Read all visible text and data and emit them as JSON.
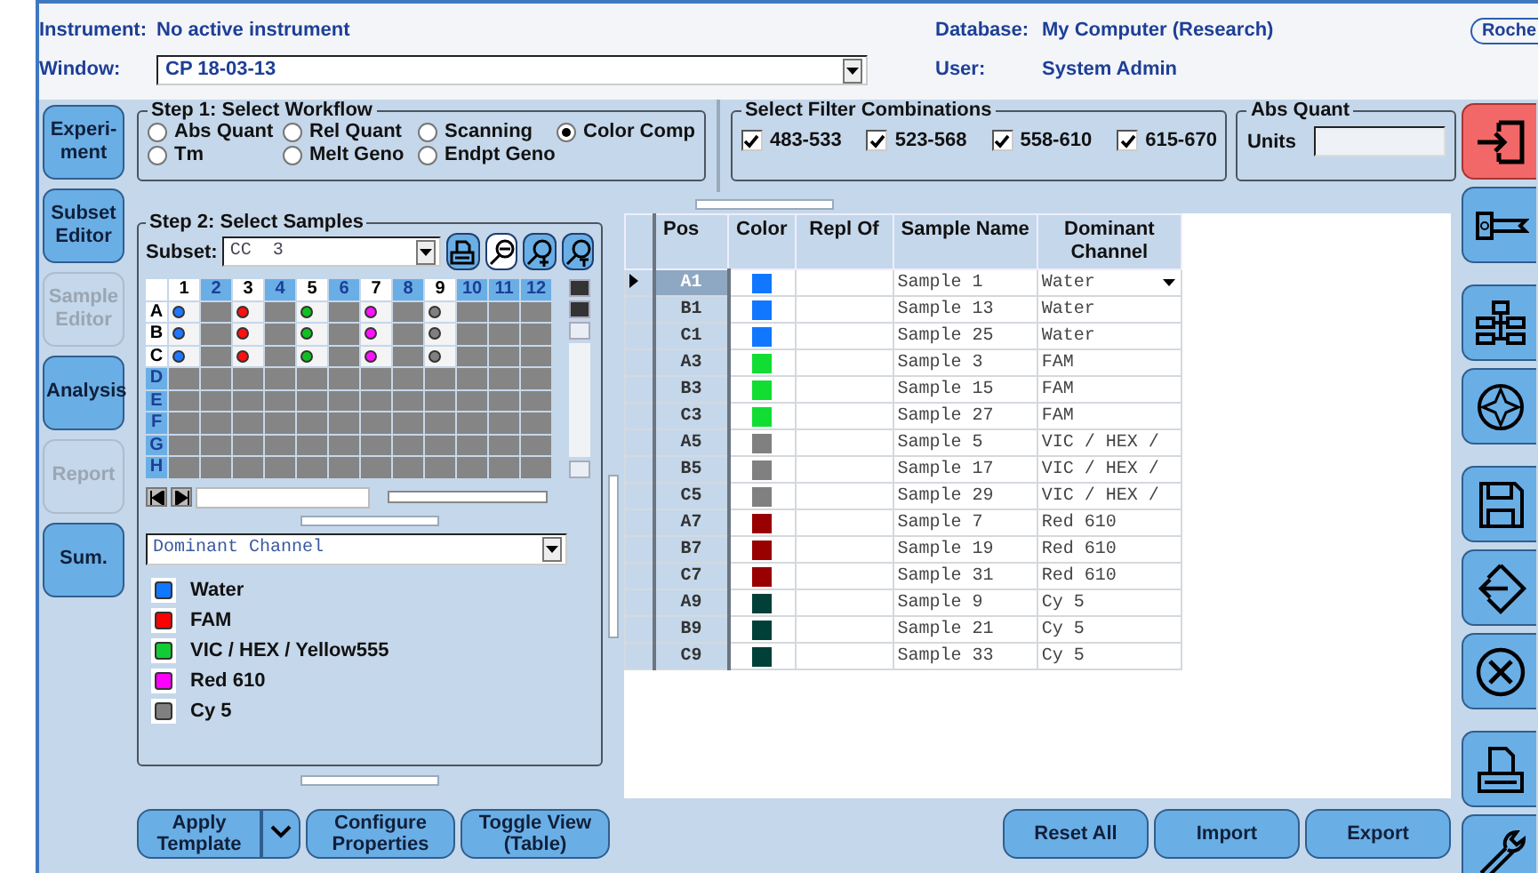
{
  "header": {
    "instrument_label": "Instrument:",
    "instrument": "No active instrument",
    "window_label": "Window:",
    "window_value": "CP 18-03-13",
    "database_label": "Database:",
    "database": "My Computer (Research)",
    "user_label": "User:",
    "user": "System Admin",
    "logo": "Roche"
  },
  "nav": [
    {
      "label": "Experi-ment",
      "disabled": false
    },
    {
      "label": "Subset Editor",
      "disabled": false
    },
    {
      "label": "Sample Editor",
      "disabled": true
    },
    {
      "label": "Analysis",
      "disabled": false
    },
    {
      "label": "Report",
      "disabled": true
    },
    {
      "label": "Sum.",
      "disabled": false
    }
  ],
  "step1": {
    "title": "Step 1: Select Workflow",
    "options": [
      {
        "label": "Abs Quant",
        "selected": false
      },
      {
        "label": "Rel Quant",
        "selected": false
      },
      {
        "label": "Scanning",
        "selected": false
      },
      {
        "label": "Color Comp",
        "selected": true
      },
      {
        "label": "Tm",
        "selected": false
      },
      {
        "label": "Melt Geno",
        "selected": false
      },
      {
        "label": "Endpt Geno",
        "selected": false
      }
    ]
  },
  "filters": {
    "title": "Select Filter Combinations",
    "items": [
      {
        "label": "483-533",
        "checked": true
      },
      {
        "label": "523-568",
        "checked": true
      },
      {
        "label": "558-610",
        "checked": true
      },
      {
        "label": "615-670",
        "checked": true
      }
    ]
  },
  "abs_quant": {
    "title": "Abs Quant",
    "units_label": "Units"
  },
  "step2": {
    "title": "Step 2: Select Samples",
    "subset_label": "Subset:",
    "subset": "CC  3",
    "plate": {
      "columns": [
        {
          "label": "1",
          "selected": true
        },
        {
          "label": "2",
          "selected": false
        },
        {
          "label": "3",
          "selected": true
        },
        {
          "label": "4",
          "selected": false
        },
        {
          "label": "5",
          "selected": true
        },
        {
          "label": "6",
          "selected": false
        },
        {
          "label": "7",
          "selected": true
        },
        {
          "label": "8",
          "selected": false
        },
        {
          "label": "9",
          "selected": true
        },
        {
          "label": "10",
          "selected": false
        },
        {
          "label": "11",
          "selected": false
        },
        {
          "label": "12",
          "selected": false
        }
      ],
      "rows": [
        {
          "label": "A",
          "selected": true,
          "wells": [
            {
              "kind": "sample",
              "color": "#1e78ff"
            },
            {
              "kind": "empty"
            },
            {
              "kind": "sample",
              "color": "#ff1010"
            },
            {
              "kind": "empty"
            },
            {
              "kind": "sample",
              "color": "#10c020"
            },
            {
              "kind": "empty"
            },
            {
              "kind": "sample",
              "color": "#ff10ff"
            },
            {
              "kind": "empty"
            },
            {
              "kind": "sample",
              "color": "#808080"
            },
            {
              "kind": "empty"
            },
            {
              "kind": "empty"
            },
            {
              "kind": "empty"
            }
          ]
        },
        {
          "label": "B",
          "selected": true,
          "wells": [
            {
              "kind": "sample",
              "color": "#1e78ff"
            },
            {
              "kind": "empty"
            },
            {
              "kind": "sample",
              "color": "#ff1010"
            },
            {
              "kind": "empty"
            },
            {
              "kind": "sample",
              "color": "#10c020"
            },
            {
              "kind": "empty"
            },
            {
              "kind": "sample",
              "color": "#ff10ff"
            },
            {
              "kind": "empty"
            },
            {
              "kind": "sample",
              "color": "#808080"
            },
            {
              "kind": "empty"
            },
            {
              "kind": "empty"
            },
            {
              "kind": "empty"
            }
          ]
        },
        {
          "label": "C",
          "selected": true,
          "wells": [
            {
              "kind": "sample",
              "color": "#1e78ff"
            },
            {
              "kind": "empty"
            },
            {
              "kind": "sample",
              "color": "#ff1010"
            },
            {
              "kind": "empty"
            },
            {
              "kind": "sample",
              "color": "#10c020"
            },
            {
              "kind": "empty"
            },
            {
              "kind": "sample",
              "color": "#ff10ff"
            },
            {
              "kind": "empty"
            },
            {
              "kind": "sample",
              "color": "#808080"
            },
            {
              "kind": "empty"
            },
            {
              "kind": "empty"
            },
            {
              "kind": "empty"
            }
          ]
        },
        {
          "label": "D",
          "selected": false,
          "wells": [
            {
              "kind": "empty"
            },
            {
              "kind": "empty"
            },
            {
              "kind": "empty"
            },
            {
              "kind": "empty"
            },
            {
              "kind": "empty"
            },
            {
              "kind": "empty"
            },
            {
              "kind": "empty"
            },
            {
              "kind": "empty"
            },
            {
              "kind": "empty"
            },
            {
              "kind": "empty"
            },
            {
              "kind": "empty"
            },
            {
              "kind": "empty"
            }
          ]
        },
        {
          "label": "E",
          "selected": false,
          "wells": [
            {
              "kind": "empty"
            },
            {
              "kind": "empty"
            },
            {
              "kind": "empty"
            },
            {
              "kind": "empty"
            },
            {
              "kind": "empty"
            },
            {
              "kind": "empty"
            },
            {
              "kind": "empty"
            },
            {
              "kind": "empty"
            },
            {
              "kind": "empty"
            },
            {
              "kind": "empty"
            },
            {
              "kind": "empty"
            },
            {
              "kind": "empty"
            }
          ]
        },
        {
          "label": "F",
          "selected": false,
          "wells": [
            {
              "kind": "empty"
            },
            {
              "kind": "empty"
            },
            {
              "kind": "empty"
            },
            {
              "kind": "empty"
            },
            {
              "kind": "empty"
            },
            {
              "kind": "empty"
            },
            {
              "kind": "empty"
            },
            {
              "kind": "empty"
            },
            {
              "kind": "empty"
            },
            {
              "kind": "empty"
            },
            {
              "kind": "empty"
            },
            {
              "kind": "empty"
            }
          ]
        },
        {
          "label": "G",
          "selected": false,
          "wells": [
            {
              "kind": "empty"
            },
            {
              "kind": "empty"
            },
            {
              "kind": "empty"
            },
            {
              "kind": "empty"
            },
            {
              "kind": "empty"
            },
            {
              "kind": "empty"
            },
            {
              "kind": "empty"
            },
            {
              "kind": "empty"
            },
            {
              "kind": "empty"
            },
            {
              "kind": "empty"
            },
            {
              "kind": "empty"
            },
            {
              "kind": "empty"
            }
          ]
        },
        {
          "label": "H",
          "selected": false,
          "wells": [
            {
              "kind": "empty"
            },
            {
              "kind": "empty"
            },
            {
              "kind": "empty"
            },
            {
              "kind": "empty"
            },
            {
              "kind": "empty"
            },
            {
              "kind": "empty"
            },
            {
              "kind": "empty"
            },
            {
              "kind": "empty"
            },
            {
              "kind": "empty"
            },
            {
              "kind": "empty"
            },
            {
              "kind": "empty"
            },
            {
              "kind": "empty"
            }
          ]
        }
      ]
    },
    "legend_select": "Dominant Channel",
    "legend": [
      {
        "label": "Water",
        "color": "#1177ff"
      },
      {
        "label": "FAM",
        "color": "#ff0000"
      },
      {
        "label": "VIC / HEX / Yellow555",
        "color": "#11cc33"
      },
      {
        "label": "Red 610",
        "color": "#ff00ff"
      },
      {
        "label": "Cy 5",
        "color": "#808080"
      }
    ]
  },
  "table": {
    "columns": [
      "Pos",
      "Color",
      "Repl Of",
      "Sample Name",
      "Dominant Channel"
    ],
    "rows": [
      {
        "pos": "A1",
        "color": "#1177ff",
        "sample_name": "Sample 1",
        "dominant_channel": "Water",
        "selected": true
      },
      {
        "pos": "B1",
        "color": "#1177ff",
        "sample_name": "Sample 13",
        "dominant_channel": "Water",
        "selected": false
      },
      {
        "pos": "C1",
        "color": "#1177ff",
        "sample_name": "Sample 25",
        "dominant_channel": "Water",
        "selected": false
      },
      {
        "pos": "A3",
        "color": "#11dd33",
        "sample_name": "Sample 3",
        "dominant_channel": "FAM",
        "selected": false
      },
      {
        "pos": "B3",
        "color": "#11dd33",
        "sample_name": "Sample 15",
        "dominant_channel": "FAM",
        "selected": false
      },
      {
        "pos": "C3",
        "color": "#11dd33",
        "sample_name": "Sample 27",
        "dominant_channel": "FAM",
        "selected": false
      },
      {
        "pos": "A5",
        "color": "#808080",
        "sample_name": "Sample 5",
        "dominant_channel": "VIC / HEX /",
        "selected": false
      },
      {
        "pos": "B5",
        "color": "#808080",
        "sample_name": "Sample 17",
        "dominant_channel": "VIC / HEX /",
        "selected": false
      },
      {
        "pos": "C5",
        "color": "#808080",
        "sample_name": "Sample 29",
        "dominant_channel": "VIC / HEX /",
        "selected": false
      },
      {
        "pos": "A7",
        "color": "#990000",
        "sample_name": "Sample 7",
        "dominant_channel": "Red 610",
        "selected": false
      },
      {
        "pos": "B7",
        "color": "#990000",
        "sample_name": "Sample 19",
        "dominant_channel": "Red 610",
        "selected": false
      },
      {
        "pos": "C7",
        "color": "#990000",
        "sample_name": "Sample 31",
        "dominant_channel": "Red 610",
        "selected": false
      },
      {
        "pos": "A9",
        "color": "#004038",
        "sample_name": "Sample 9",
        "dominant_channel": "Cy 5",
        "selected": false
      },
      {
        "pos": "B9",
        "color": "#004038",
        "sample_name": "Sample 21",
        "dominant_channel": "Cy 5",
        "selected": false
      },
      {
        "pos": "C9",
        "color": "#004038",
        "sample_name": "Sample 33",
        "dominant_channel": "Cy 5",
        "selected": false
      }
    ]
  },
  "buttons_left": [
    {
      "label": "Apply Template",
      "kind": "split"
    },
    {
      "label": "Configure Properties",
      "kind": "plain"
    },
    {
      "label": "Toggle View (Table)",
      "kind": "plain"
    }
  ],
  "buttons_right": [
    {
      "label": "Reset All"
    },
    {
      "label": "Import"
    },
    {
      "label": "Export"
    }
  ]
}
